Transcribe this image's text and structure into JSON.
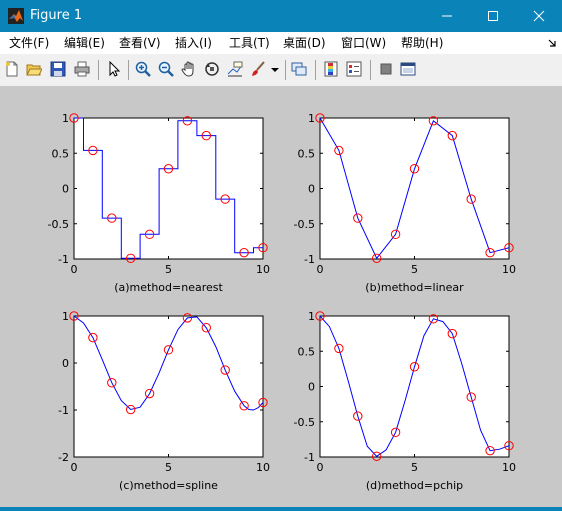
{
  "window": {
    "title": "Figure 1"
  },
  "menu": [
    {
      "label": "文件(F)"
    },
    {
      "label": "编辑(E)"
    },
    {
      "label": "查看(V)"
    },
    {
      "label": "插入(I)"
    },
    {
      "label": "工具(T)"
    },
    {
      "label": "桌面(D)"
    },
    {
      "label": "窗口(W)"
    },
    {
      "label": "帮助(H)"
    }
  ],
  "toolbar": [
    "new-figure-icon",
    "open-file-icon",
    "save-icon",
    "print-icon",
    "select-arrow-icon",
    "zoom-in-icon",
    "zoom-out-icon",
    "pan-hand-icon",
    "rotate-3d-icon",
    "data-cursor-icon",
    "brush-icon",
    "brush-dropdown-icon",
    "link-plot-icon",
    "colorbar-icon",
    "legend-icon",
    "hide-plot-tools-icon",
    "show-plot-tools-icon"
  ],
  "colors": {
    "line": "#0000ff",
    "marker": "#ff0000",
    "axes_bg": "#ffffff",
    "figure_bg": "#c8c8c8",
    "titlebar": "#0a84b8"
  },
  "chart_data": [
    {
      "type": "line",
      "xlabel": "(a)method=nearest",
      "xlim": [
        0,
        10
      ],
      "ylim": [
        -1,
        1
      ],
      "xticks": [
        "0",
        "5",
        "10"
      ],
      "yticks": [
        "-1",
        "-0.5",
        "0",
        "0.5",
        "1"
      ],
      "marker_x": [
        0,
        1,
        2,
        3,
        4,
        5,
        6,
        7,
        8,
        9,
        10
      ],
      "marker_y": [
        1.0,
        0.54,
        -0.42,
        -0.99,
        -0.65,
        0.28,
        0.96,
        0.75,
        -0.15,
        -0.91,
        -0.84
      ],
      "line_x": [
        0,
        0.5,
        0.5,
        1.5,
        1.5,
        2.5,
        2.5,
        3.5,
        3.5,
        4.5,
        4.5,
        5.5,
        5.5,
        6.5,
        6.5,
        7.5,
        7.5,
        8.5,
        8.5,
        9.5,
        9.5,
        10
      ],
      "line_y": [
        1.0,
        1.0,
        0.54,
        0.54,
        -0.42,
        -0.42,
        -0.99,
        -0.99,
        -0.65,
        -0.65,
        0.28,
        0.28,
        0.96,
        0.96,
        0.75,
        0.75,
        -0.15,
        -0.15,
        -0.91,
        -0.91,
        -0.84,
        -0.84
      ]
    },
    {
      "type": "line",
      "xlabel": "(b)method=linear",
      "xlim": [
        0,
        10
      ],
      "ylim": [
        -1,
        1
      ],
      "xticks": [
        "0",
        "5",
        "10"
      ],
      "yticks": [
        "-1",
        "-0.5",
        "0",
        "0.5",
        "1"
      ],
      "marker_x": [
        0,
        1,
        2,
        3,
        4,
        5,
        6,
        7,
        8,
        9,
        10
      ],
      "marker_y": [
        1.0,
        0.54,
        -0.42,
        -0.99,
        -0.65,
        0.28,
        0.96,
        0.75,
        -0.15,
        -0.91,
        -0.84
      ],
      "line_x": [
        0,
        1,
        2,
        3,
        4,
        5,
        6,
        7,
        8,
        9,
        10
      ],
      "line_y": [
        1.0,
        0.54,
        -0.42,
        -0.99,
        -0.65,
        0.28,
        0.96,
        0.75,
        -0.15,
        -0.91,
        -0.84
      ]
    },
    {
      "type": "line",
      "xlabel": "(c)method=spline",
      "xlim": [
        0,
        10
      ],
      "ylim": [
        -2,
        1
      ],
      "xticks": [
        "0",
        "5",
        "10"
      ],
      "yticks": [
        "-2",
        "-1",
        "0",
        "1"
      ],
      "marker_x": [
        0,
        1,
        2,
        3,
        4,
        5,
        6,
        7,
        8,
        9,
        10
      ],
      "marker_y": [
        1.0,
        0.54,
        -0.42,
        -0.99,
        -0.65,
        0.28,
        0.96,
        0.75,
        -0.15,
        -0.91,
        -0.84
      ],
      "line_x": [
        0,
        0.5,
        1,
        1.5,
        2,
        2.5,
        3,
        3.5,
        4,
        4.5,
        5,
        5.5,
        6,
        6.5,
        7,
        7.5,
        8,
        8.5,
        9,
        9.25,
        9.5,
        9.75,
        10
      ],
      "line_y": [
        1.0,
        0.85,
        0.54,
        0.07,
        -0.42,
        -0.8,
        -0.99,
        -0.94,
        -0.65,
        -0.21,
        0.28,
        0.71,
        0.96,
        0.98,
        0.75,
        0.35,
        -0.15,
        -0.6,
        -0.91,
        -0.99,
        -1.0,
        -0.95,
        -0.84
      ]
    },
    {
      "type": "line",
      "xlabel": "(d)method=pchip",
      "xlim": [
        0,
        10
      ],
      "ylim": [
        -1,
        1
      ],
      "xticks": [
        "0",
        "5",
        "10"
      ],
      "yticks": [
        "-1",
        "-0.5",
        "0",
        "0.5",
        "1"
      ],
      "marker_x": [
        0,
        1,
        2,
        3,
        4,
        5,
        6,
        7,
        8,
        9,
        10
      ],
      "marker_y": [
        1.0,
        0.54,
        -0.42,
        -0.99,
        -0.65,
        0.28,
        0.96,
        0.75,
        -0.15,
        -0.91,
        -0.84
      ],
      "line_x": [
        0,
        0.5,
        1,
        1.5,
        2,
        2.5,
        3,
        3.5,
        4,
        4.5,
        5,
        5.5,
        6,
        6.5,
        7,
        7.5,
        8,
        8.5,
        9,
        9.5,
        10
      ],
      "line_y": [
        1.0,
        0.85,
        0.54,
        0.07,
        -0.42,
        -0.85,
        -0.99,
        -0.9,
        -0.65,
        -0.2,
        0.28,
        0.72,
        0.96,
        0.92,
        0.75,
        0.32,
        -0.15,
        -0.62,
        -0.91,
        -0.89,
        -0.84
      ]
    }
  ]
}
